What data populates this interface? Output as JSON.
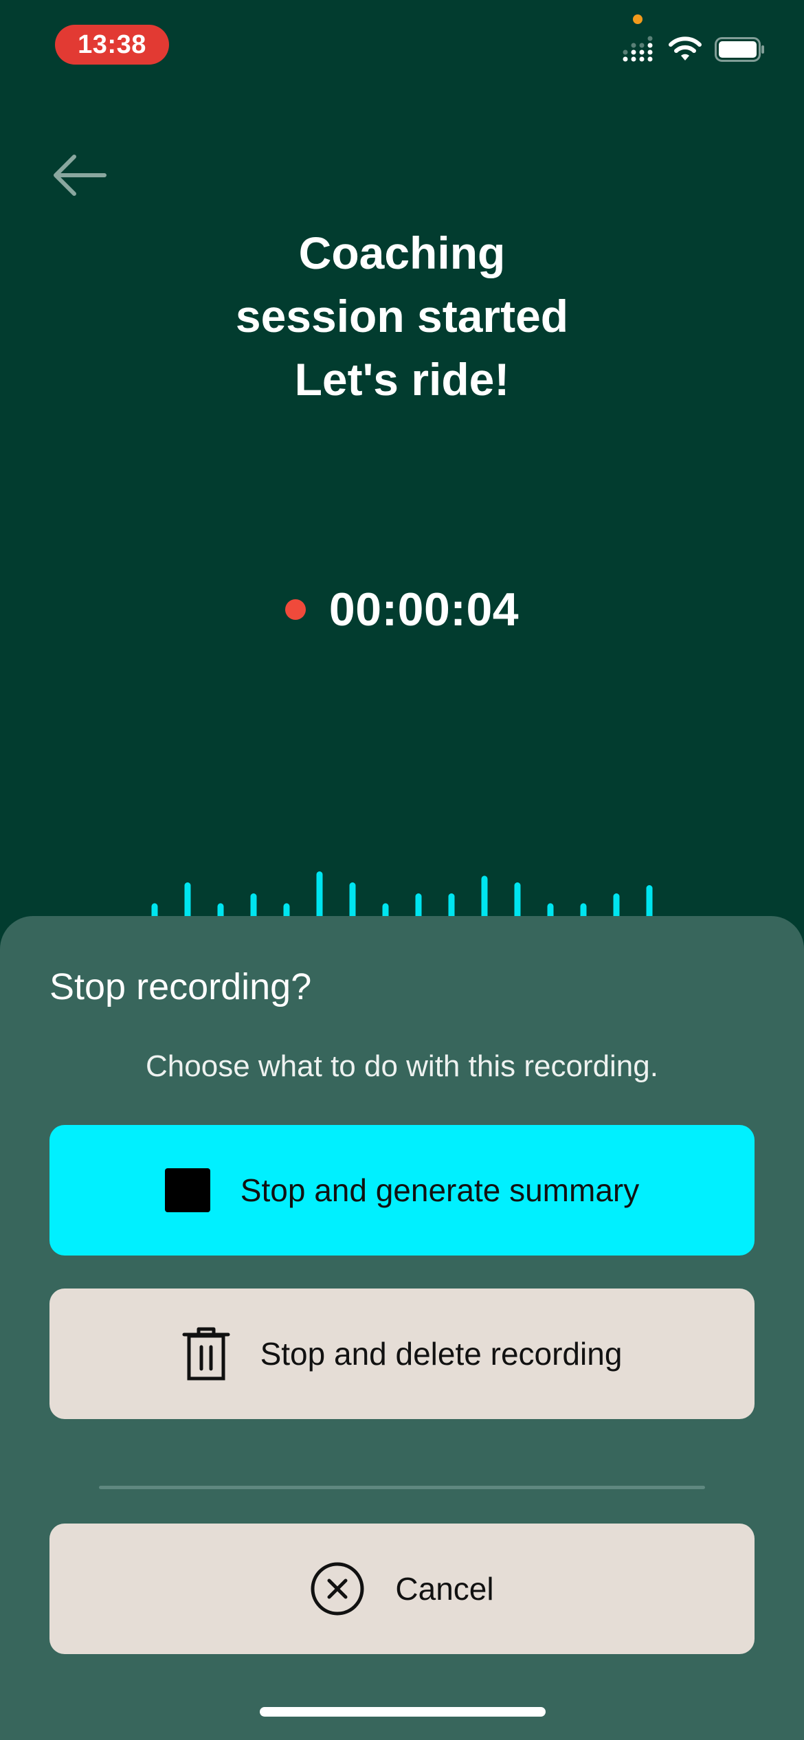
{
  "status_bar": {
    "time": "13:38"
  },
  "colors": {
    "background": "#023c2f",
    "sheet": "#38665c",
    "accent": "#00f0ff",
    "secondary_button": "#e5ddd6",
    "recording_dot": "#f04a3b",
    "waveform": "#00e5f0",
    "time_pill": "#e23a33"
  },
  "header": {
    "back_icon": "arrow-left-icon",
    "title_lines": [
      "Coaching",
      "session started",
      "Let's ride!"
    ]
  },
  "recording": {
    "status_icon": "recording-dot-icon",
    "timer": "00:00:04",
    "waveform_levels": [
      0.22,
      0.6,
      0.22,
      0.4,
      0.22,
      0.8,
      0.6,
      0.22,
      0.4,
      0.4,
      0.72,
      0.6,
      0.22,
      0.22,
      0.4,
      0.55
    ]
  },
  "sheet": {
    "title": "Stop recording?",
    "subtitle": "Choose what to do with this recording.",
    "actions": {
      "summary": {
        "label": "Stop and generate summary",
        "icon": "stop-icon"
      },
      "delete": {
        "label": "Stop and delete recording",
        "icon": "trash-icon"
      },
      "cancel": {
        "label": "Cancel",
        "icon": "close-circle-icon"
      }
    }
  }
}
